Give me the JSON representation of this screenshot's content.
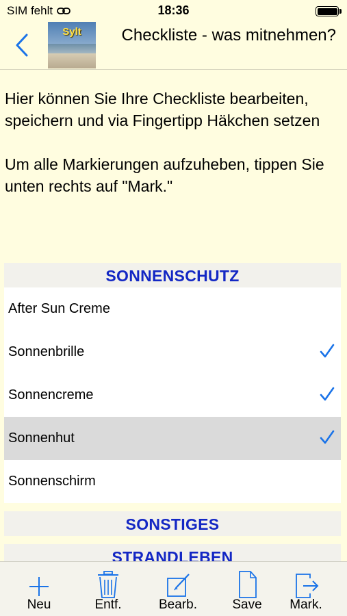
{
  "status_bar": {
    "carrier": "SIM fehlt",
    "time": "18:36"
  },
  "nav": {
    "title": "Checkliste - was mitnehmen?",
    "thumbnail_label": "Sylt"
  },
  "intro": {
    "paragraph1": "Hier können Sie Ihre Checkliste bearbeiten, speichern und via Fingertipp Häkchen setzen",
    "paragraph2": "Um alle Markierungen aufzuheben, tippen Sie unten rechts auf \"Mark.\""
  },
  "sections": [
    {
      "title": "SONNENSCHUTZ",
      "items": [
        {
          "label": "After Sun Creme",
          "checked": false
        },
        {
          "label": "Sonnenbrille",
          "checked": true
        },
        {
          "label": "Sonnencreme",
          "checked": true
        },
        {
          "label": "Sonnenhut",
          "checked": true,
          "selected": true
        },
        {
          "label": "Sonnenschirm",
          "checked": false
        }
      ]
    },
    {
      "title": "SONSTIGES",
      "items": []
    },
    {
      "title": "STRANDLEBEN",
      "items": []
    }
  ],
  "toolbar": {
    "new_label": "Neu",
    "delete_label": "Entf.",
    "edit_label": "Bearb.",
    "save_label": "Save",
    "mark_label": "Mark."
  },
  "colors": {
    "accent": "#1a73e8",
    "section_header": "#1327c4",
    "background": "#fffde0"
  },
  "icons": [
    "back-chevron-icon",
    "link-icon",
    "battery-icon",
    "checkmark-icon",
    "plus-icon",
    "trash-icon",
    "edit-icon",
    "document-icon",
    "export-icon"
  ]
}
